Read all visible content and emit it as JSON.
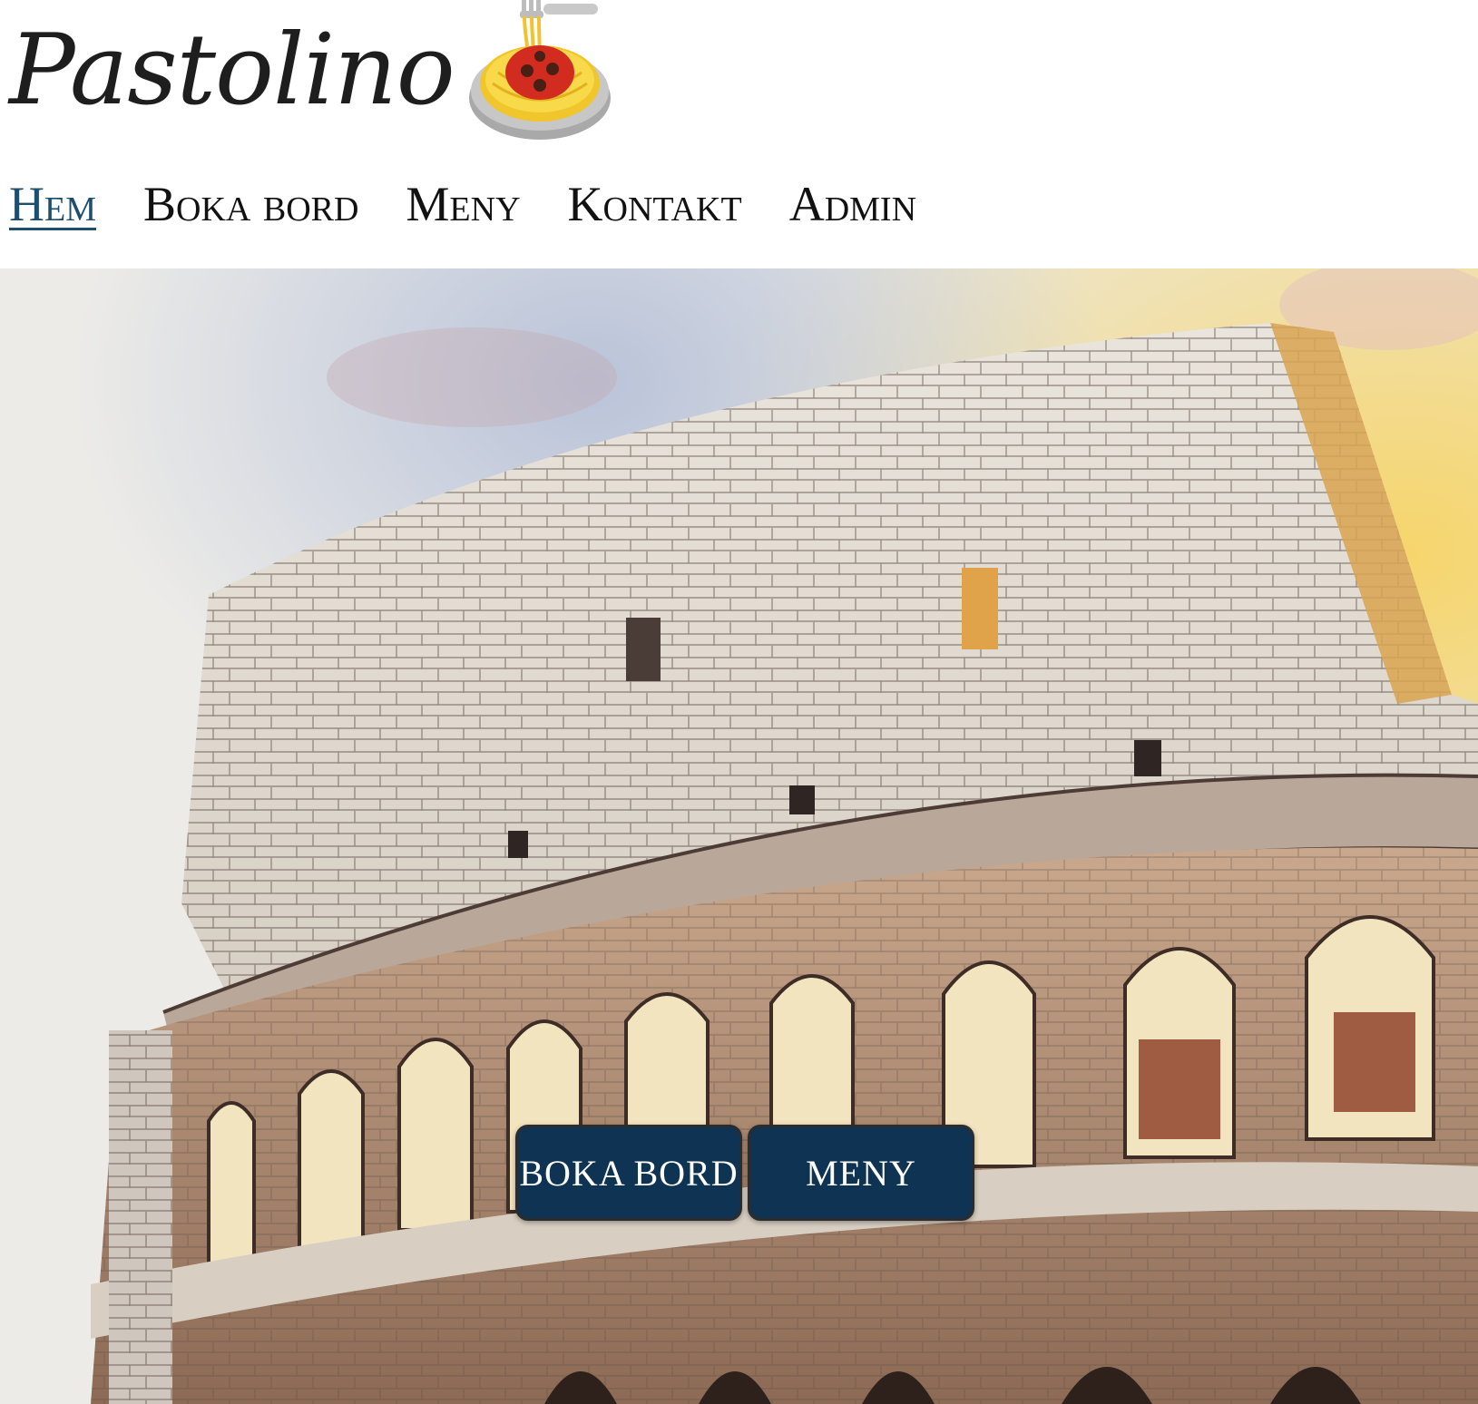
{
  "brand": {
    "name": "Pastolino",
    "logo_icon": "spaghetti-bowl-icon"
  },
  "nav": {
    "items": [
      {
        "label": "Hem",
        "active": true
      },
      {
        "label": "Boka bord",
        "active": false
      },
      {
        "label": "Meny",
        "active": false
      },
      {
        "label": "Kontakt",
        "active": false
      },
      {
        "label": "Admin",
        "active": false
      }
    ]
  },
  "hero": {
    "image": "colosseum-watercolor-illustration",
    "buttons": {
      "book_label": "BOKA BORD",
      "menu_label": "MENY"
    }
  },
  "colors": {
    "nav_active": "#1d4e6e",
    "button_bg": "#0f3352",
    "text": "#111111"
  }
}
